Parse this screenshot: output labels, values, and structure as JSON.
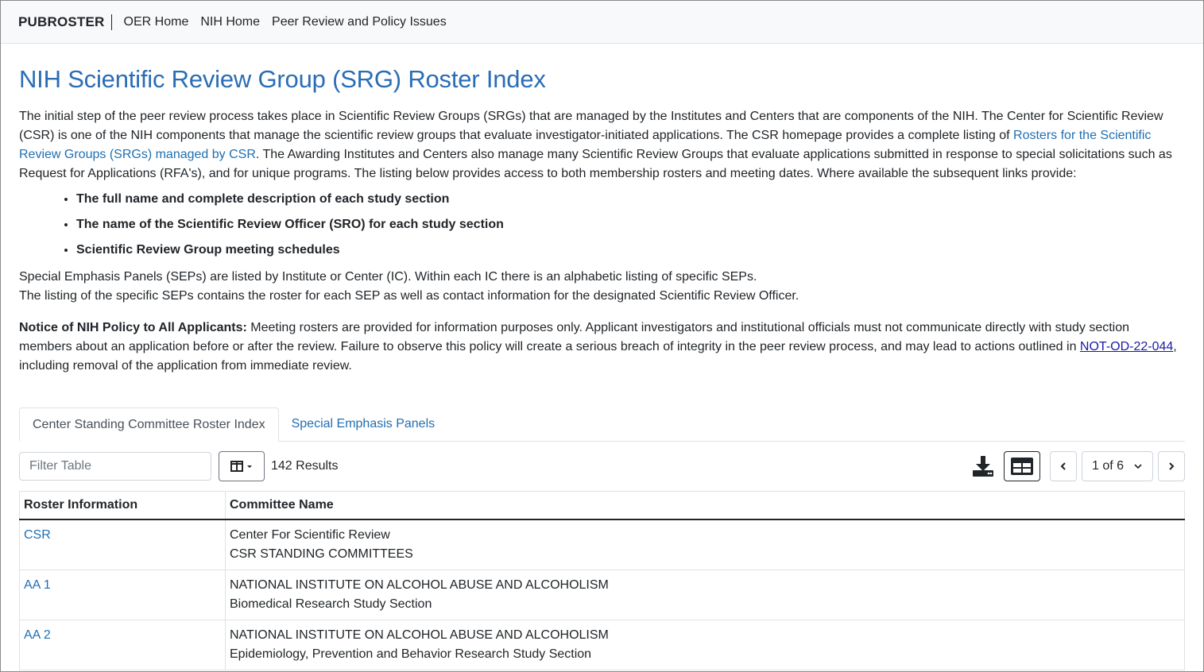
{
  "navbar": {
    "brand": "PUBROSTER",
    "links": [
      "OER Home",
      "NIH Home",
      "Peer Review and Policy Issues"
    ]
  },
  "page": {
    "title": "NIH Scientific Review Group (SRG) Roster Index",
    "intro_part1": "The initial step of the peer review process takes place in Scientific Review Groups (SRGs) that are managed by the Institutes and Centers that are components of the NIH. The Center for Scientific Review (CSR) is one of the NIH components that manage the scientific review groups that evaluate investigator-initiated applications. The CSR homepage provides a complete listing of ",
    "intro_link": "Rosters for the Scientific Review Groups (SRGs) managed by CSR",
    "intro_part2": ". The Awarding Institutes and Centers also manage many Scientific Review Groups that evaluate applications submitted in response to special solicitations such as Request for Applications (RFA's), and for unique programs. The listing below provides access to both membership rosters and meeting dates. Where available the subsequent links provide:",
    "bullets": [
      "The full name and complete description of each study section",
      "The name of the Scientific Review Officer (SRO) for each study section",
      "Scientific Review Group meeting schedules"
    ],
    "sep_line1": "Special Emphasis Panels (SEPs) are listed by Institute or Center (IC). Within each IC there is an alphabetic listing of specific SEPs.",
    "sep_line2": "The listing of the specific SEPs contains the roster for each SEP as well as contact information for the designated Scientific Review Officer.",
    "notice_label": "Notice of NIH Policy to All Applicants:",
    "notice_text": " Meeting rosters are provided for information purposes only. Applicant investigators and institutional officials must not communicate directly with study section members about an application before or after the review. Failure to observe this policy will create a serious breach of integrity in the peer review process, and may lead to actions outlined in ",
    "notice_link": "NOT-OD-22-044",
    "notice_end": ", including removal of the application from immediate review."
  },
  "tabs": [
    {
      "label": "Center Standing Committee Roster Index",
      "active": true
    },
    {
      "label": "Special Emphasis Panels",
      "active": false
    }
  ],
  "toolbar": {
    "filter_placeholder": "Filter Table",
    "results": "142 Results",
    "page_select": "1 of 6",
    "icons": [
      "columns-icon",
      "download-icon",
      "grid-view-icon",
      "chevron-left-icon",
      "chevron-right-icon"
    ]
  },
  "table": {
    "headers": [
      "Roster Information",
      "Committee Name"
    ],
    "rows": [
      {
        "code": "CSR",
        "line1": "Center For Scientific Review",
        "line2": "CSR STANDING COMMITTEES"
      },
      {
        "code": "AA 1",
        "line1": "NATIONAL INSTITUTE ON ALCOHOL ABUSE AND ALCOHOLISM",
        "line2": "Biomedical Research Study Section"
      },
      {
        "code": "AA 2",
        "line1": "NATIONAL INSTITUTE ON ALCOHOL ABUSE AND ALCOHOLISM",
        "line2": "Epidemiology, Prevention and Behavior Research Study Section"
      }
    ]
  },
  "colors": {
    "title": "#2a6db5",
    "link": "#1f6fb2",
    "navbar_bg": "#f8f9fa"
  }
}
